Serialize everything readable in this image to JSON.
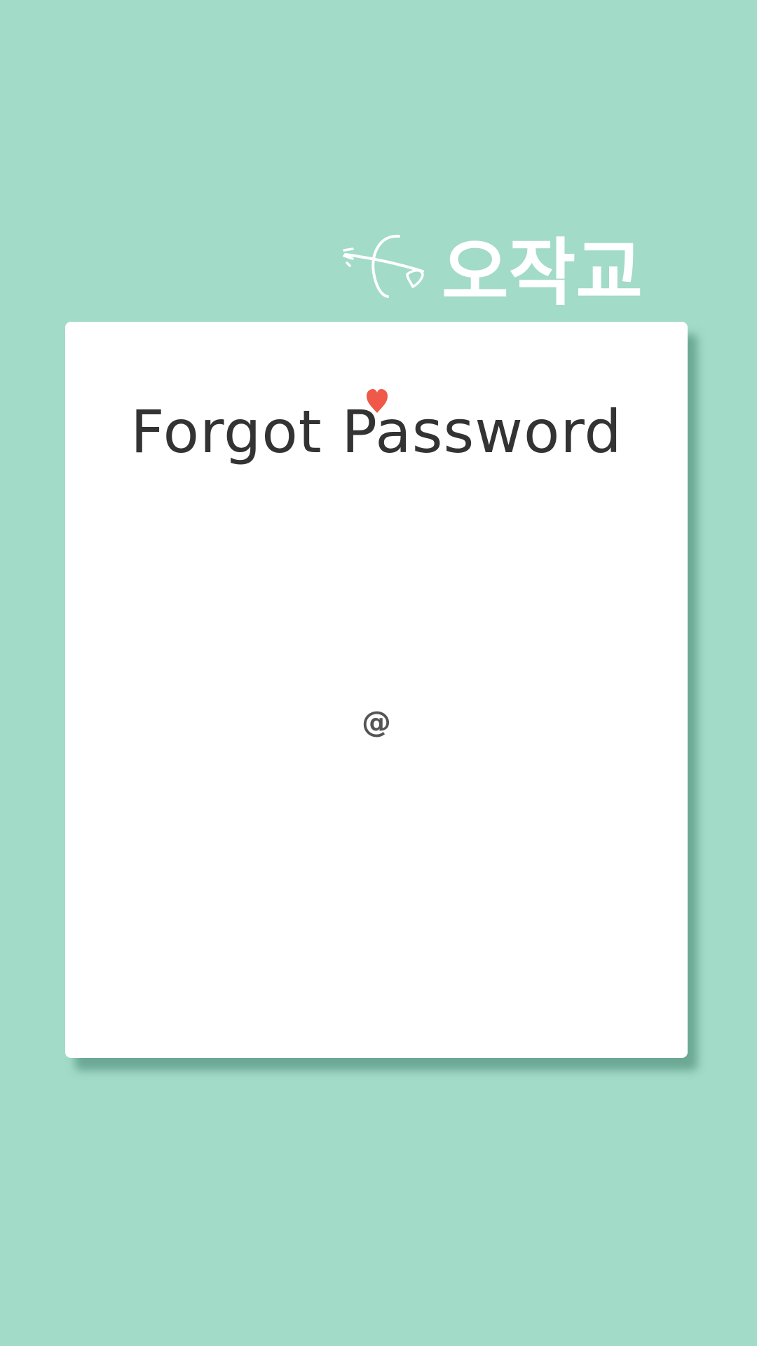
{
  "logo": {
    "name": "logo",
    "text": "오작교"
  },
  "form": {
    "title": "Forgot Password",
    "email_icon": "@"
  },
  "colors": {
    "background": "#a2dbc8",
    "card": "#ffffff",
    "title_text": "#333333",
    "heart": "#f0584a",
    "icon": "#555555",
    "logo": "#ffffff"
  },
  "icons": {
    "heart": "heart-icon",
    "email": "at-icon",
    "arrow": "cupid-arrow-icon"
  }
}
